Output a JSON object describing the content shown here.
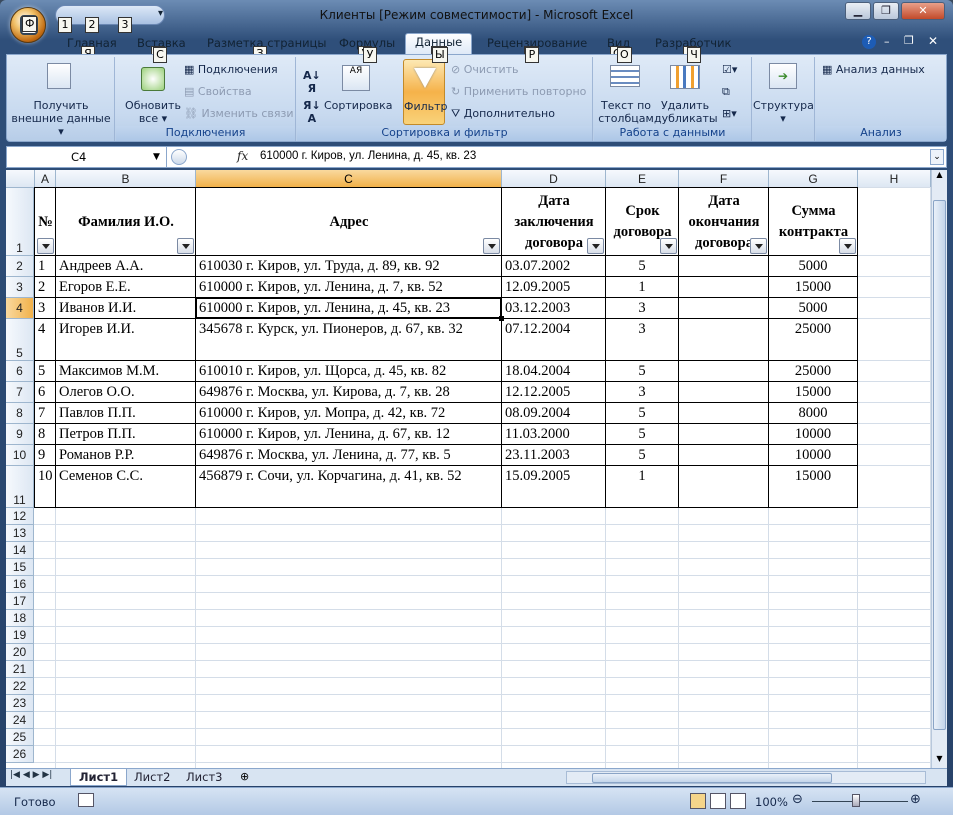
{
  "window": {
    "title": "Клиенты  [Режим совместимости] - Microsoft Excel"
  },
  "keytips": {
    "office": "Ф",
    "qat": [
      "1",
      "2",
      "3"
    ],
    "tabs": [
      "Я",
      "С",
      "З",
      "У",
      "Ы",
      "Р",
      "О",
      "Ч"
    ]
  },
  "tabs": [
    "Главная",
    "Вставка",
    "Разметка страницы",
    "Формулы",
    "Данные",
    "Рецензирование",
    "Вид",
    "Разработчик"
  ],
  "ribbon": {
    "get_external": "Получить внешние данные",
    "refresh_all": "Обновить все",
    "connections": "Подключения",
    "properties": "Свойства",
    "edit_links": "Изменить связи",
    "group_connections": "Подключения",
    "sort": "Сортировка",
    "filter": "Фильтр",
    "clear": "Очистить",
    "reapply": "Применить повторно",
    "advanced": "Дополнительно",
    "group_sort": "Сортировка и фильтр",
    "text_to_columns": "Текст по столбцам",
    "remove_duplicates": "Удалить дубликаты",
    "group_data": "Работа с данными",
    "outline": "Структура",
    "data_analysis": "Анализ данных",
    "group_analysis": "Анализ"
  },
  "formula_bar": {
    "name_box": "C4",
    "fx": "fx",
    "value": "610000 г. Киров, ул. Ленина, д. 45, кв. 23"
  },
  "columns": [
    "A",
    "B",
    "C",
    "D",
    "E",
    "F",
    "G",
    "H"
  ],
  "rows": [
    "1",
    "2",
    "3",
    "4",
    "5",
    "6",
    "7",
    "8",
    "9",
    "10",
    "11",
    "12",
    "13",
    "14",
    "15",
    "16",
    "17",
    "18",
    "19",
    "20",
    "21",
    "22",
    "23",
    "24",
    "25",
    "26"
  ],
  "headers": {
    "num": "№",
    "name": "Фамилия И.О.",
    "address": "Адрес",
    "start": [
      "Дата",
      "заключения",
      "договора"
    ],
    "term": [
      "Срок",
      "договора"
    ],
    "end": [
      "Дата",
      "окончания",
      "договора"
    ],
    "sum": [
      "Сумма",
      "контракта"
    ]
  },
  "data": [
    [
      "1",
      "Андреев А.А.",
      "610030 г. Киров, ул. Труда, д. 89, кв. 92",
      "03.07.2002",
      "5",
      "",
      "5000"
    ],
    [
      "2",
      "Егоров Е.Е.",
      "610000 г. Киров, ул. Ленина, д. 7, кв. 52",
      "12.09.2005",
      "1",
      "",
      "15000"
    ],
    [
      "3",
      "Иванов И.И.",
      "610000 г. Киров, ул. Ленина, д. 45, кв. 23",
      "03.12.2003",
      "3",
      "",
      "5000"
    ],
    [
      "4",
      "Игорев И.И.",
      "345678 г. Курск, ул. Пионеров, д. 67, кв. 32",
      "07.12.2004",
      "3",
      "",
      "25000"
    ],
    [
      "5",
      "Максимов М.М.",
      "610010 г. Киров, ул. Щорса, д. 45, кв. 82",
      "18.04.2004",
      "5",
      "",
      "25000"
    ],
    [
      "6",
      "Олегов О.О.",
      "649876 г. Москва, ул. Кирова, д. 7, кв. 28",
      "12.12.2005",
      "3",
      "",
      "15000"
    ],
    [
      "7",
      "Павлов П.П.",
      "610000 г. Киров, ул. Мопра, д. 42, кв. 72",
      "08.09.2004",
      "5",
      "",
      "8000"
    ],
    [
      "8",
      "Петров П.П.",
      "610000 г. Киров, ул. Ленина, д. 67, кв. 12",
      "11.03.2000",
      "5",
      "",
      "10000"
    ],
    [
      "9",
      "Романов Р.Р.",
      "649876 г. Москва, ул. Ленина, д. 77, кв. 5",
      "23.11.2003",
      "5",
      "",
      "10000"
    ],
    [
      "10",
      "Семенов С.С.",
      "456879 г. Сочи, ул. Корчагина, д. 41, кв. 52",
      "15.09.2005",
      "1",
      "",
      "15000"
    ]
  ],
  "sheets": [
    "Лист1",
    "Лист2",
    "Лист3"
  ],
  "status": {
    "ready": "Готово",
    "zoom": "100%"
  }
}
